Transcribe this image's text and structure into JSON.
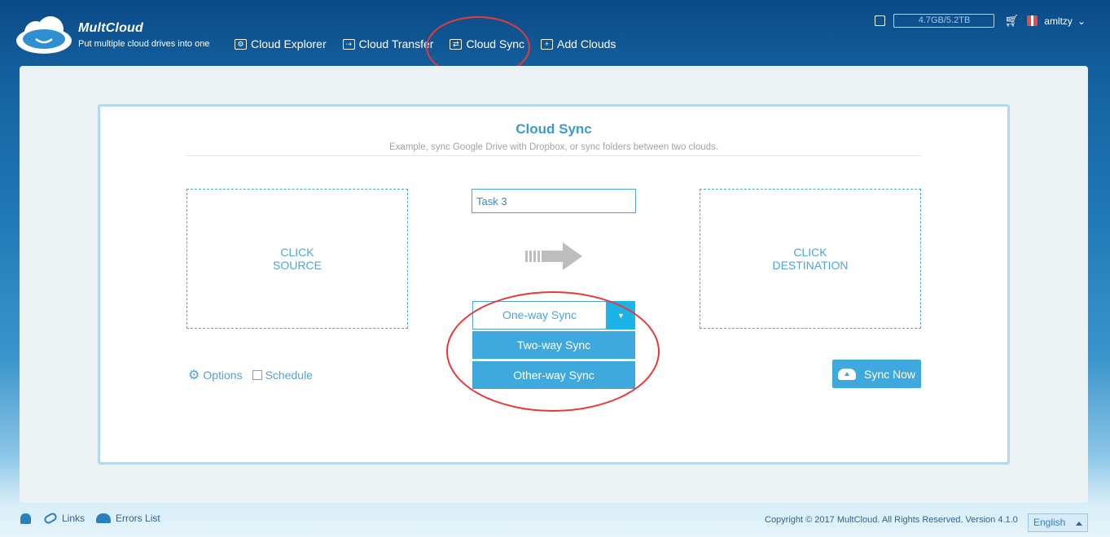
{
  "header": {
    "logo_name": "MultCloud",
    "logo_tagline": "Put multiple cloud drives into one",
    "nav": [
      {
        "label": "Cloud Explorer",
        "icon": "explorer-icon"
      },
      {
        "label": "Cloud Transfer",
        "icon": "transfer-icon"
      },
      {
        "label": "Cloud Sync",
        "icon": "sync-icon"
      },
      {
        "label": "Add Clouds",
        "icon": "add-icon"
      }
    ],
    "storage": "4.7GB/5.2TB",
    "user": "amltzy"
  },
  "sync": {
    "title": "Cloud Sync",
    "subtitle": "Example, sync Google Drive with Dropbox, or sync folders between two clouds.",
    "source_line1": "CLICK",
    "source_line2": "SOURCE",
    "destination_line1": "CLICK",
    "destination_line2": "DESTINATION",
    "task_name": "Task 3",
    "mode_selected": "One-way Sync",
    "mode_options": [
      "Two-way Sync",
      "Other-way Sync"
    ],
    "options_label": "Options",
    "schedule_label": "Schedule",
    "sync_now_label": "Sync Now"
  },
  "footer": {
    "links_label": "Links",
    "errors_label": "Errors List",
    "copyright": "Copyright © 2017 MultCloud. All Rights Reserved. Version 4.1.0",
    "language": "English"
  },
  "colors": {
    "accent": "#3fa9dd",
    "annotation": "#e63a3a"
  }
}
